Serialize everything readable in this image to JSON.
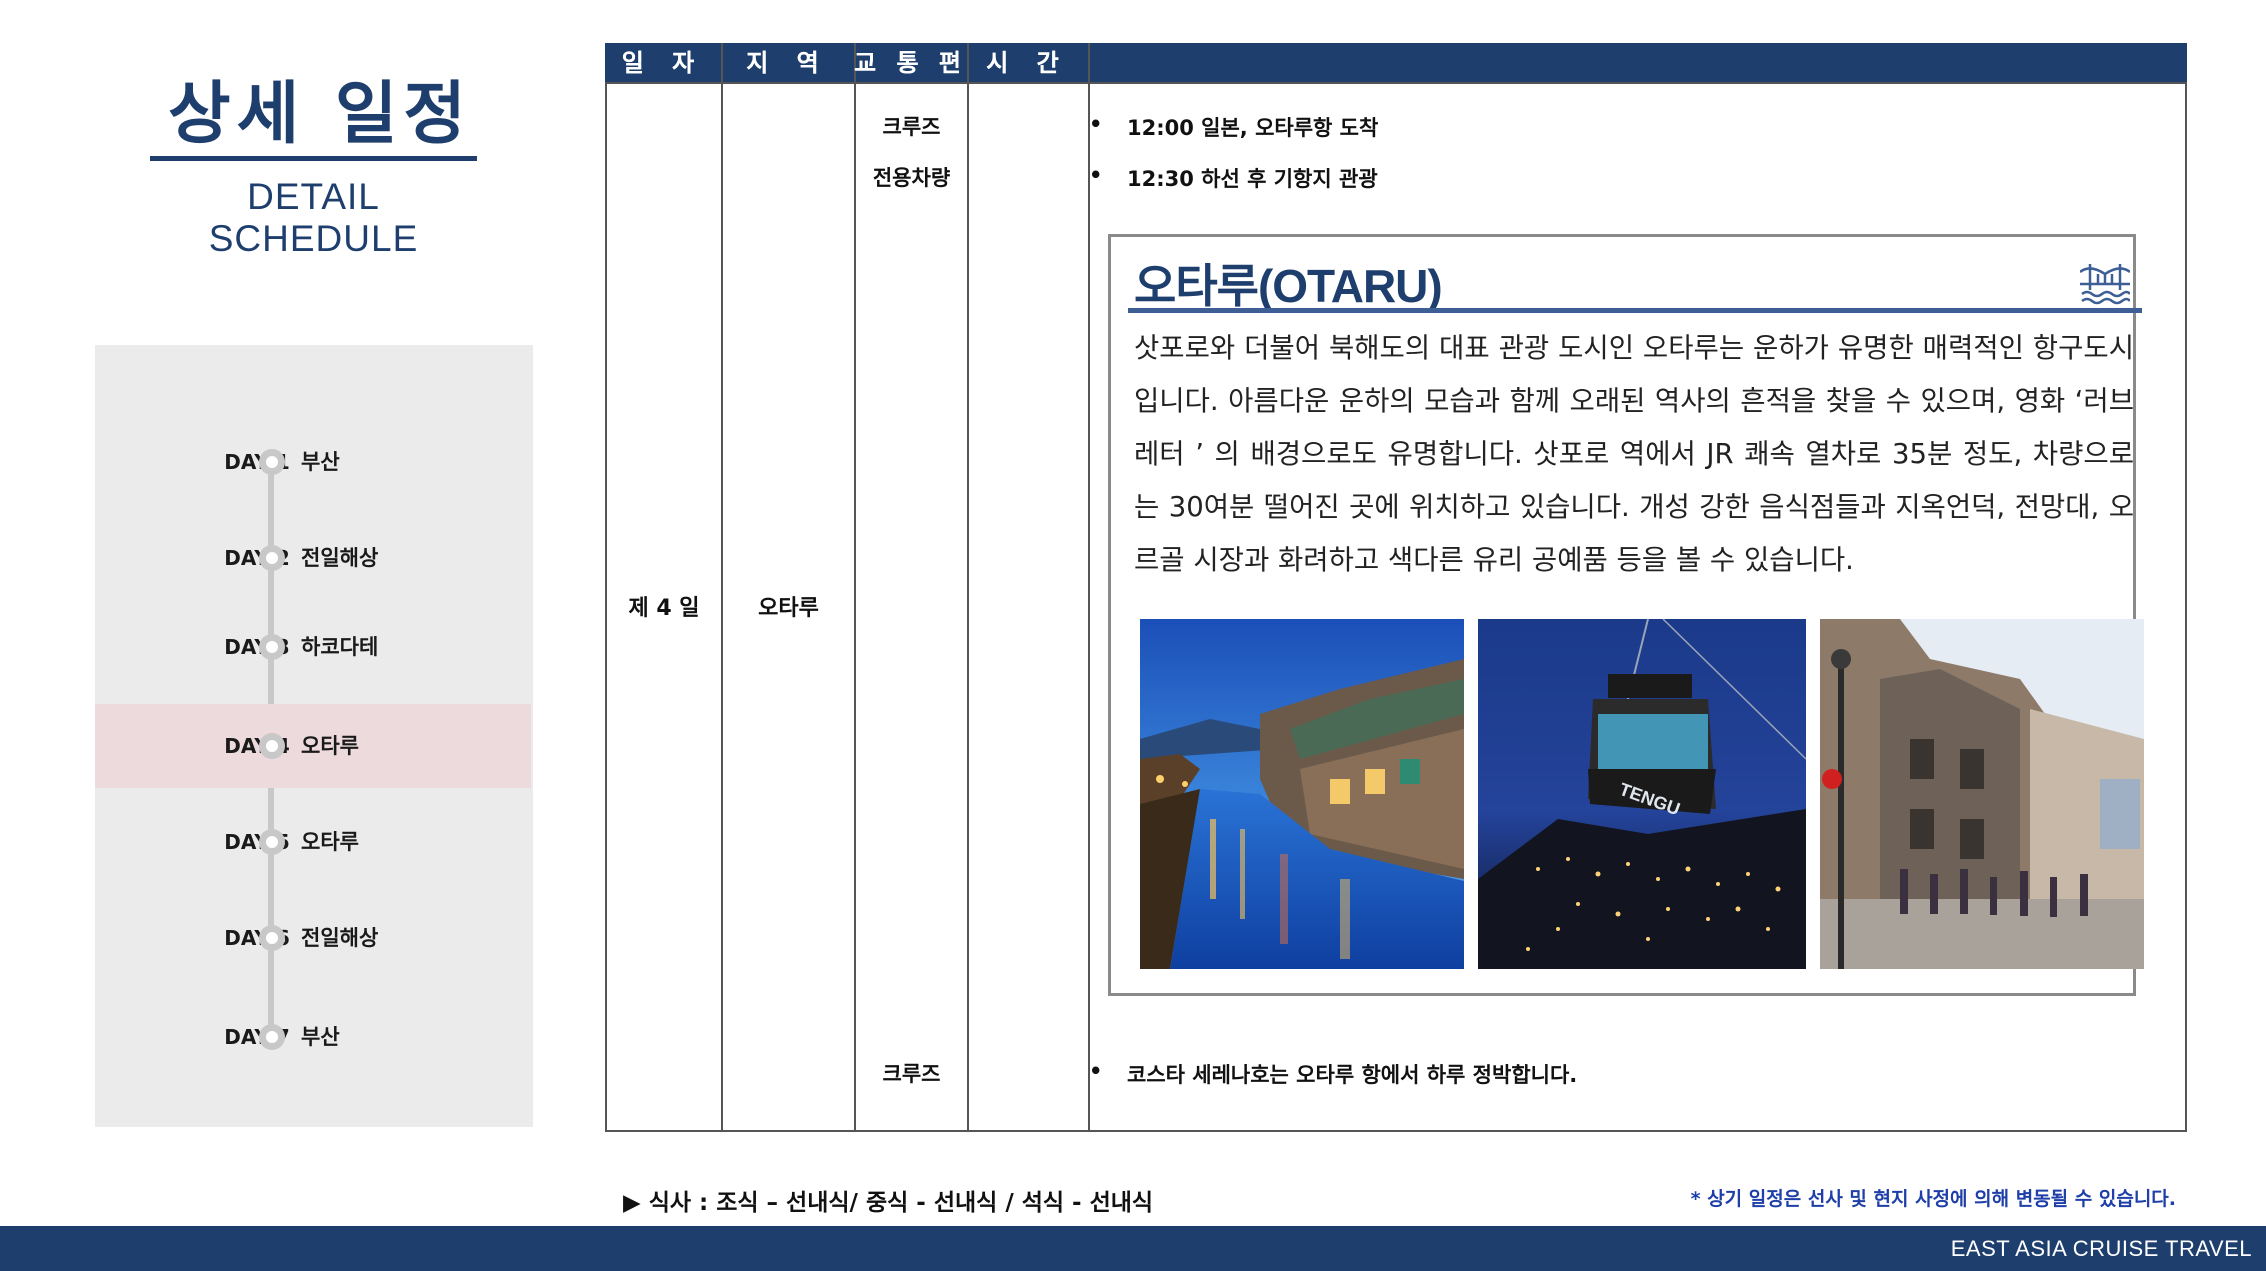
{
  "header": {
    "title_ko": "상세 일정",
    "title_en": "DETAIL SCHEDULE"
  },
  "days": [
    {
      "label": "DAY 1",
      "place": "부산",
      "active": false
    },
    {
      "label": "DAY 2",
      "place": "전일해상",
      "active": false
    },
    {
      "label": "DAY 3",
      "place": "하코다테",
      "active": false
    },
    {
      "label": "DAY 4",
      "place": "오타루",
      "active": true
    },
    {
      "label": "DAY 5",
      "place": "오타루",
      "active": false
    },
    {
      "label": "DAY 6",
      "place": "전일해상",
      "active": false
    },
    {
      "label": "DAY 7",
      "place": "부산",
      "active": false
    }
  ],
  "table": {
    "headers": {
      "date": "일 자",
      "region": "지 역",
      "transport": "교 통 편",
      "time": "시 간",
      "details": ""
    },
    "day": "제 4 일",
    "region": "오타루",
    "transport": [
      "크루즈",
      "전용차량",
      "크루즈"
    ],
    "bullets": [
      "12:00 일본, 오타루항 도착",
      "12:30 하선 후 기항지 관광",
      "코스타 세레나호는 오타루 항에서 하루 정박합니다."
    ]
  },
  "otaru": {
    "title": "오타루(OTARU)",
    "description": "삿포로와 더불어 북해도의 대표 관광 도시인 오타루는 운하가 유명한 매력적인 항구도시입니다. 아름다운 운하의 모습과 함께 오래된 역사의 흔적을 찾을 수 있으며, 영화 ‘러브레터 ’ 의 배경으로도 유명합니다. 삿포로 역에서 JR 쾌속 열차로 35분 정도, 차량으로는 30여분 떨어진 곳에 위치하고 있습니다. 개성 강한 음식점들과 지옥언덕, 전망대, 오르골 시장과 화려하고 색다른 유리 공예품 등을 볼 수 있습니다.",
    "icon": "bridge-icon",
    "photos": [
      "otaru-canal-night-photo",
      "tengu-ropeway-night-view-photo",
      "otaru-street-photo"
    ],
    "cable_car_text": "TENGU"
  },
  "meal": "▶ 식사 : 조식 – 선내식/ 중식 - 선내식 / 석식 - 선내식",
  "note": "* 상기 일정은 선사 및 현지 사정에 의해 변동될 수 있습니다.",
  "footer": "EAST ASIA CRUISE TRAVEL",
  "colors": {
    "navy": "#1e3f6e",
    "active_row": "#ecdadd",
    "panel": "#ebebeb",
    "note_blue": "#1e3fa8"
  }
}
